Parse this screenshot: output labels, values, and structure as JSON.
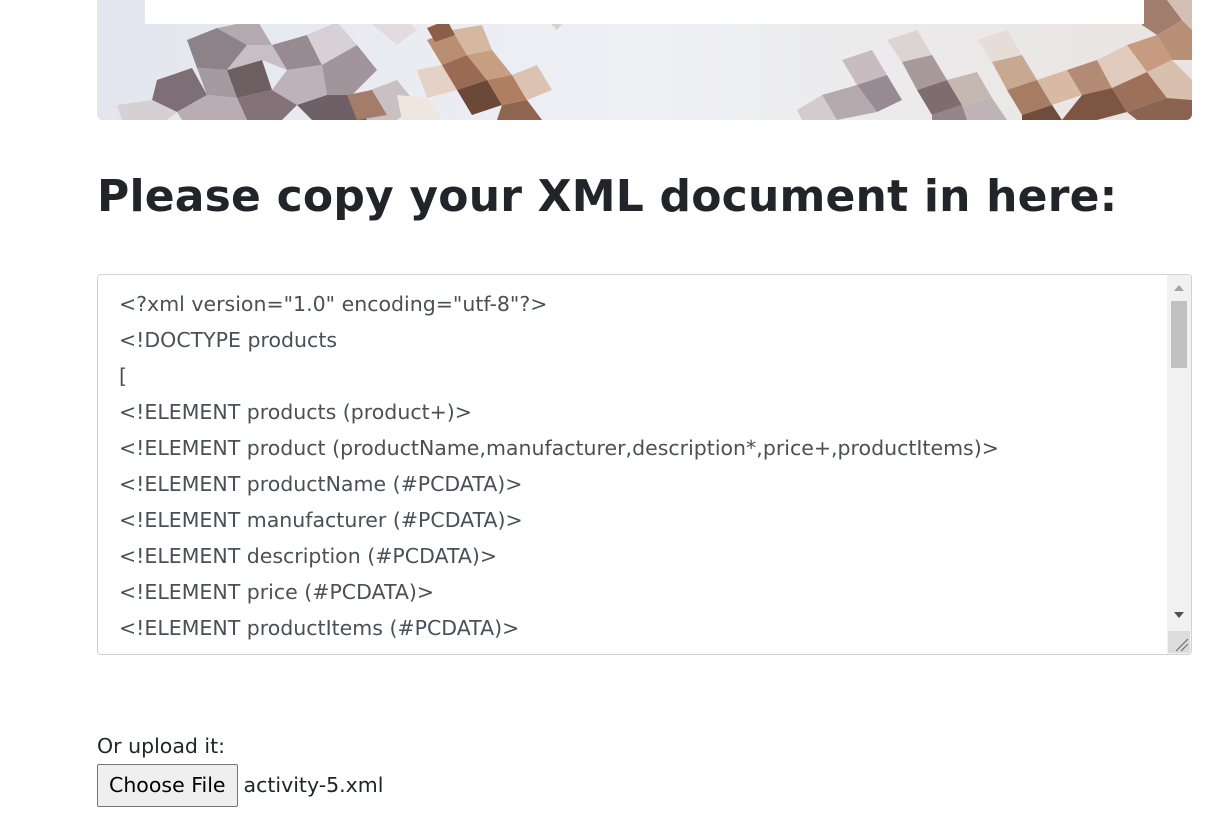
{
  "heading": "Please copy your XML document in here:",
  "xml_input": {
    "lines": [
      "<?xml version=\"1.0\" encoding=\"utf-8\"?>",
      "<!DOCTYPE products",
      "[",
      "<!ELEMENT products (product+)>",
      "<!ELEMENT product (productName,manufacturer,description*,price+,productItems)>",
      "<!ELEMENT productName (#PCDATA)>",
      "<!ELEMENT manufacturer (#PCDATA)>",
      "<!ELEMENT description (#PCDATA)>",
      "<!ELEMENT price (#PCDATA)>",
      "<!ELEMENT productItems (#PCDATA)>"
    ]
  },
  "upload": {
    "label": "Or upload it:",
    "button_label": "Choose File",
    "file_name": "activity-5.xml"
  },
  "colors": {
    "heading": "#212529",
    "code_text": "#495057",
    "input_border": "#ced4da",
    "scrollbar_track": "#f1f1f1",
    "scrollbar_thumb": "#c1c1c1"
  },
  "icons": {
    "scroll_up": "triangle-up-icon",
    "scroll_down": "triangle-down-icon",
    "resize": "resize-grip-icon"
  }
}
